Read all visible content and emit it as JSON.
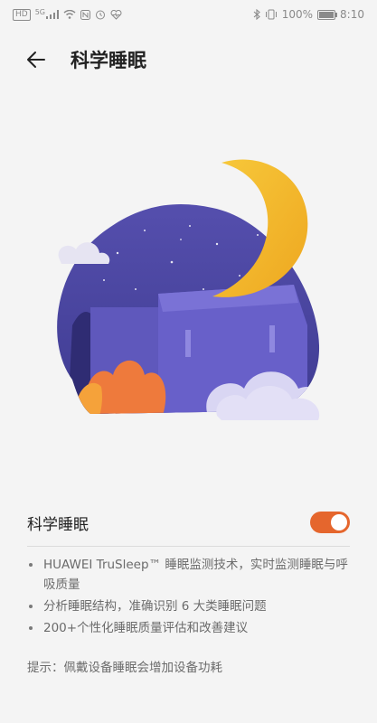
{
  "status_bar": {
    "left": {
      "hd": "HD",
      "network": "5G"
    },
    "right": {
      "battery_percent": "100%",
      "time": "8:10"
    },
    "icons_left": [
      "hd-badge",
      "signal-icon",
      "wifi-icon",
      "nfc-icon",
      "alarm-icon",
      "heart-icon"
    ],
    "icons_right": [
      "bluetooth-icon",
      "vibrate-icon",
      "battery-icon"
    ]
  },
  "header": {
    "back_icon": "arrow-left-icon",
    "title": "科学睡眠"
  },
  "setting": {
    "label": "科学睡眠",
    "toggle_on": true,
    "toggle_color": "#e5662d"
  },
  "features": [
    "HUAWEI TruSleep™ 睡眠监测技术，实时监测睡眠与呼吸质量",
    "分析睡眠结构，准确识别 6 大类睡眠问题",
    "200+个性化睡眠质量评估和改善建议"
  ],
  "tip": "提示：佩戴设备睡眠会增加设备功耗",
  "colors": {
    "background": "#f4f4f4",
    "night_sky": "#4e4aa8",
    "moon": "#f3b928",
    "accent": "#e5662d"
  }
}
